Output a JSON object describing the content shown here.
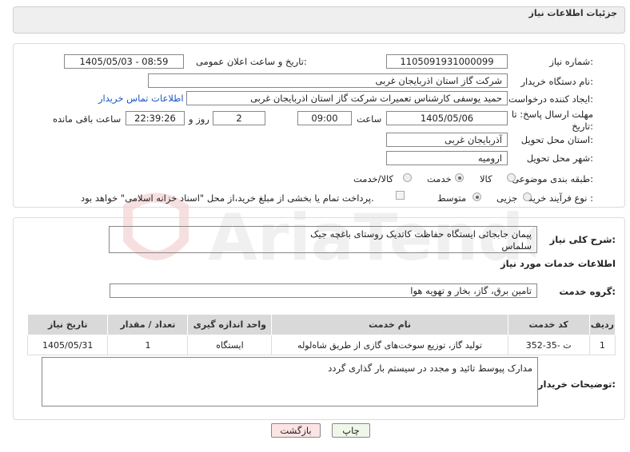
{
  "header": {
    "title": "جزئیات اطلاعات نیاز"
  },
  "form": {
    "need_number_label": "شماره نیاز:",
    "need_number": "1105091931000099",
    "announce_label": "تاریخ و ساعت اعلان عمومی:",
    "announce_value": "1405/05/03 - 08:59",
    "buyer_org_label": "نام دستگاه خریدار:",
    "buyer_org": "شرکت گاز استان اذربایجان غربی",
    "creator_label": "ایجاد کننده درخواست:",
    "creator": "حمید یوسفی کارشناس تعمیرات شرکت گاز استان اذربایجان غربی",
    "buyer_contact_link": "اطلاعات تماس خریدار",
    "deadline_label_1": "مهلت ارسال پاسخ: تا",
    "deadline_label_2": "تاریخ:",
    "deadline_date": "1405/05/06",
    "time_label": "ساعت",
    "deadline_time": "09:00",
    "days_value": "2",
    "days_label": "روز و",
    "remaining_time": "22:39:26",
    "remaining_label": "ساعت باقی مانده",
    "province_label": "استان محل تحویل:",
    "province": "آذربایجان غربی",
    "city_label": "شهر محل تحویل:",
    "city": "ارومیه",
    "category_label": "طبقه بندی موضوعی:",
    "category_options": [
      "کالا",
      "خدمت",
      "کالا/خدمت"
    ],
    "category_selected": "خدمت",
    "process_label": "نوع فرآیند خرید :",
    "process_options": [
      "جزیی",
      "متوسط"
    ],
    "process_selected": "متوسط",
    "payment_note": "پرداخت تمام یا بخشی از مبلغ خرید،از محل \"اسناد خزانه اسلامی\" خواهد بود."
  },
  "description": {
    "label": "شرح کلی نیاز:",
    "line1": "پیمان جابجائی ایستگاه حفاظت کاتدیک روستای باغچه جیک",
    "line2": "سلماس"
  },
  "services": {
    "section_title": "اطلاعات خدمات مورد نیاز",
    "group_label": "گروه خدمت:",
    "group_value": "تامین برق، گاز، بخار و تهویه هوا",
    "columns": [
      "ردیف",
      "کد خدمت",
      "نام خدمت",
      "واحد اندازه گیری",
      "تعداد / مقدار",
      "تاریخ نیاز"
    ],
    "rows": [
      [
        "1",
        "ت -35-352",
        "تولید گاز، توزیع سوخت‌های گازی از طریق شاه‌لوله",
        "ایستگاه",
        "1",
        "1405/05/31"
      ]
    ]
  },
  "buyer_notes": {
    "label": "توضیحات خریدار:",
    "text": "مدارک پیوسط تائید و مجدد در سیستم بار گذاری گردد"
  },
  "buttons": {
    "print": "چاپ",
    "back": "بازگشت"
  },
  "colors": {
    "link": "#1a56c4",
    "header_bg": "#efefef",
    "table_header_bg": "#d9d9d9",
    "back_button_bg": "#fde4e4",
    "print_button_bg": "#eef7e8"
  }
}
